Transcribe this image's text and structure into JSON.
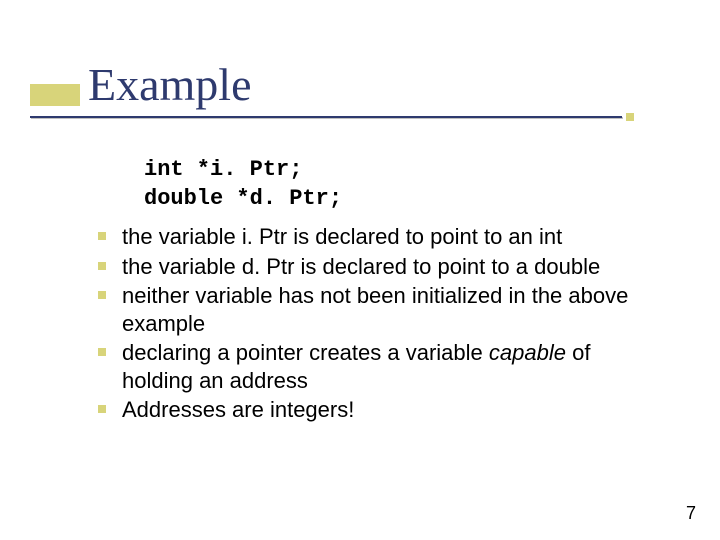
{
  "title": "Example",
  "code": {
    "line1": "int *i. Ptr;",
    "line2": "double *d. Ptr;"
  },
  "bullets": [
    {
      "before": "the variable i. Ptr is declared to point to an int",
      "italic": "",
      "after": ""
    },
    {
      "before": "the variable d. Ptr is declared to point to a double",
      "italic": "",
      "after": ""
    },
    {
      "before": "neither variable has not been initialized in the above example",
      "italic": "",
      "after": ""
    },
    {
      "before": "declaring a pointer creates a variable ",
      "italic": "capable",
      "after": " of holding an address"
    },
    {
      "before": "Addresses are integers!",
      "italic": "",
      "after": ""
    }
  ],
  "page_number": "7"
}
